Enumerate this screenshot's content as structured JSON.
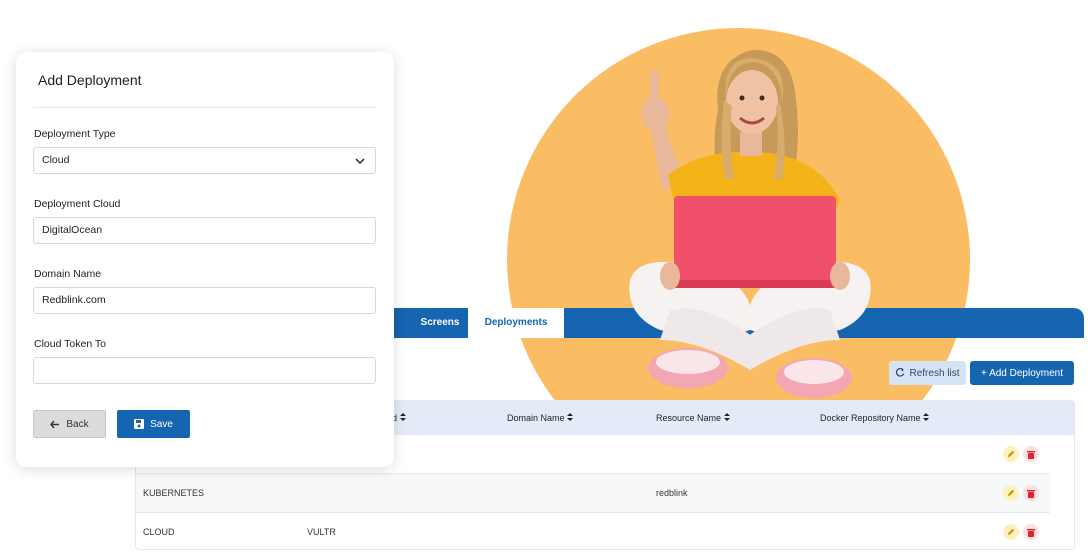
{
  "modal": {
    "title": "Add Deployment",
    "fields": [
      {
        "label": "Deployment Type",
        "value": "Cloud",
        "kind": "select"
      },
      {
        "label": "Deployment Cloud",
        "value": "DigitalOcean",
        "kind": "text"
      },
      {
        "label": "Domain Name",
        "value": "Redblink.com",
        "kind": "text"
      },
      {
        "label": "Cloud Token To",
        "value": "",
        "kind": "text"
      }
    ],
    "back_label": "Back",
    "save_label": "Save"
  },
  "tabs": [
    {
      "label": "Screens",
      "active": false
    },
    {
      "label": "Deployments",
      "active": true
    }
  ],
  "toolbar": {
    "refresh_label": "Refresh list",
    "add_label": "+ Add Deployment"
  },
  "table": {
    "headers": [
      "d",
      "Domain Name",
      "Resource Name",
      "Docker Repository Name"
    ],
    "rows": [
      {
        "type": "",
        "cloud": "",
        "domain": "",
        "resource": ""
      },
      {
        "type": "KUBERNETES",
        "cloud": "",
        "domain": "",
        "resource": "redblink"
      },
      {
        "type": "CLOUD",
        "cloud": "VULTR",
        "domain": "",
        "resource": ""
      }
    ]
  },
  "colors": {
    "primary": "#1565b0",
    "sun": "#fbbd63",
    "shirt": "#f5b31a",
    "laptop": "#f0506a"
  },
  "icons": {
    "select": "chevron-down-icon",
    "back": "arrow-left-icon",
    "save": "floppy-disk-icon",
    "refresh": "refresh-icon",
    "sort": "sort-icon",
    "edit": "pencil-icon",
    "delete": "trash-icon"
  }
}
